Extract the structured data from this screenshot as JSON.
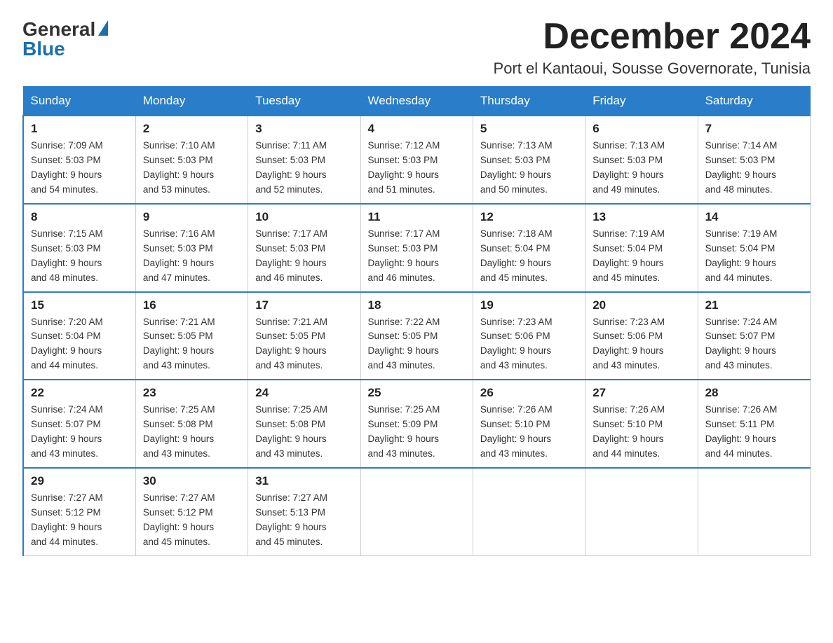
{
  "logo": {
    "general": "General",
    "blue": "Blue"
  },
  "title": "December 2024",
  "location": "Port el Kantaoui, Sousse Governorate, Tunisia",
  "days_of_week": [
    "Sunday",
    "Monday",
    "Tuesday",
    "Wednesday",
    "Thursday",
    "Friday",
    "Saturday"
  ],
  "weeks": [
    [
      {
        "day": "1",
        "sunrise": "7:09 AM",
        "sunset": "5:03 PM",
        "daylight": "9 hours and 54 minutes."
      },
      {
        "day": "2",
        "sunrise": "7:10 AM",
        "sunset": "5:03 PM",
        "daylight": "9 hours and 53 minutes."
      },
      {
        "day": "3",
        "sunrise": "7:11 AM",
        "sunset": "5:03 PM",
        "daylight": "9 hours and 52 minutes."
      },
      {
        "day": "4",
        "sunrise": "7:12 AM",
        "sunset": "5:03 PM",
        "daylight": "9 hours and 51 minutes."
      },
      {
        "day": "5",
        "sunrise": "7:13 AM",
        "sunset": "5:03 PM",
        "daylight": "9 hours and 50 minutes."
      },
      {
        "day": "6",
        "sunrise": "7:13 AM",
        "sunset": "5:03 PM",
        "daylight": "9 hours and 49 minutes."
      },
      {
        "day": "7",
        "sunrise": "7:14 AM",
        "sunset": "5:03 PM",
        "daylight": "9 hours and 48 minutes."
      }
    ],
    [
      {
        "day": "8",
        "sunrise": "7:15 AM",
        "sunset": "5:03 PM",
        "daylight": "9 hours and 48 minutes."
      },
      {
        "day": "9",
        "sunrise": "7:16 AM",
        "sunset": "5:03 PM",
        "daylight": "9 hours and 47 minutes."
      },
      {
        "day": "10",
        "sunrise": "7:17 AM",
        "sunset": "5:03 PM",
        "daylight": "9 hours and 46 minutes."
      },
      {
        "day": "11",
        "sunrise": "7:17 AM",
        "sunset": "5:03 PM",
        "daylight": "9 hours and 46 minutes."
      },
      {
        "day": "12",
        "sunrise": "7:18 AM",
        "sunset": "5:04 PM",
        "daylight": "9 hours and 45 minutes."
      },
      {
        "day": "13",
        "sunrise": "7:19 AM",
        "sunset": "5:04 PM",
        "daylight": "9 hours and 45 minutes."
      },
      {
        "day": "14",
        "sunrise": "7:19 AM",
        "sunset": "5:04 PM",
        "daylight": "9 hours and 44 minutes."
      }
    ],
    [
      {
        "day": "15",
        "sunrise": "7:20 AM",
        "sunset": "5:04 PM",
        "daylight": "9 hours and 44 minutes."
      },
      {
        "day": "16",
        "sunrise": "7:21 AM",
        "sunset": "5:05 PM",
        "daylight": "9 hours and 43 minutes."
      },
      {
        "day": "17",
        "sunrise": "7:21 AM",
        "sunset": "5:05 PM",
        "daylight": "9 hours and 43 minutes."
      },
      {
        "day": "18",
        "sunrise": "7:22 AM",
        "sunset": "5:05 PM",
        "daylight": "9 hours and 43 minutes."
      },
      {
        "day": "19",
        "sunrise": "7:23 AM",
        "sunset": "5:06 PM",
        "daylight": "9 hours and 43 minutes."
      },
      {
        "day": "20",
        "sunrise": "7:23 AM",
        "sunset": "5:06 PM",
        "daylight": "9 hours and 43 minutes."
      },
      {
        "day": "21",
        "sunrise": "7:24 AM",
        "sunset": "5:07 PM",
        "daylight": "9 hours and 43 minutes."
      }
    ],
    [
      {
        "day": "22",
        "sunrise": "7:24 AM",
        "sunset": "5:07 PM",
        "daylight": "9 hours and 43 minutes."
      },
      {
        "day": "23",
        "sunrise": "7:25 AM",
        "sunset": "5:08 PM",
        "daylight": "9 hours and 43 minutes."
      },
      {
        "day": "24",
        "sunrise": "7:25 AM",
        "sunset": "5:08 PM",
        "daylight": "9 hours and 43 minutes."
      },
      {
        "day": "25",
        "sunrise": "7:25 AM",
        "sunset": "5:09 PM",
        "daylight": "9 hours and 43 minutes."
      },
      {
        "day": "26",
        "sunrise": "7:26 AM",
        "sunset": "5:10 PM",
        "daylight": "9 hours and 43 minutes."
      },
      {
        "day": "27",
        "sunrise": "7:26 AM",
        "sunset": "5:10 PM",
        "daylight": "9 hours and 44 minutes."
      },
      {
        "day": "28",
        "sunrise": "7:26 AM",
        "sunset": "5:11 PM",
        "daylight": "9 hours and 44 minutes."
      }
    ],
    [
      {
        "day": "29",
        "sunrise": "7:27 AM",
        "sunset": "5:12 PM",
        "daylight": "9 hours and 44 minutes."
      },
      {
        "day": "30",
        "sunrise": "7:27 AM",
        "sunset": "5:12 PM",
        "daylight": "9 hours and 45 minutes."
      },
      {
        "day": "31",
        "sunrise": "7:27 AM",
        "sunset": "5:13 PM",
        "daylight": "9 hours and 45 minutes."
      },
      null,
      null,
      null,
      null
    ]
  ],
  "labels": {
    "sunrise": "Sunrise:",
    "sunset": "Sunset:",
    "daylight": "Daylight:"
  }
}
